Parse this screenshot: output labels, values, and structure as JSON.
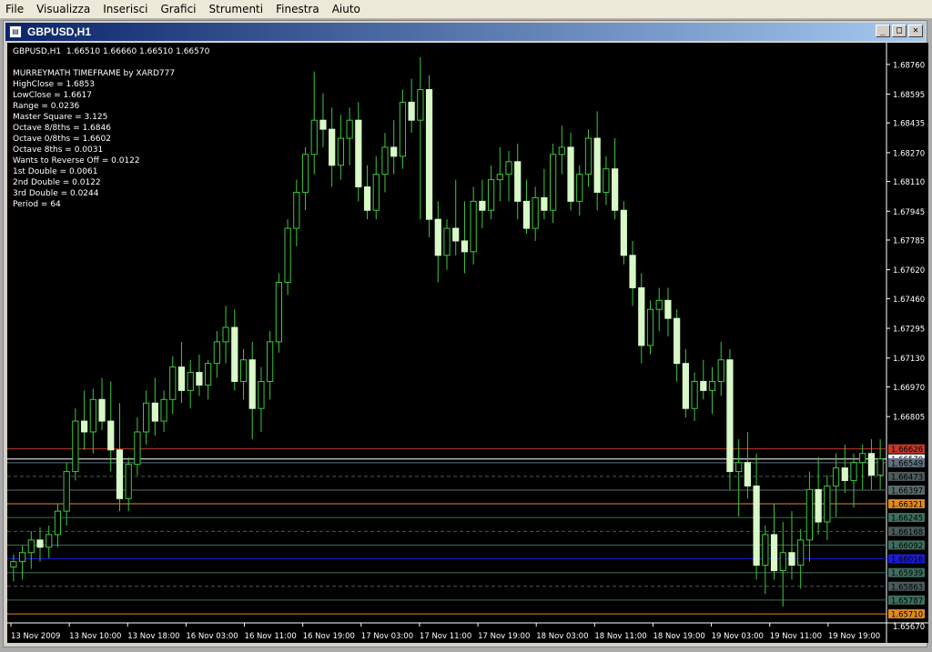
{
  "menu": [
    "File",
    "Visualizza",
    "Inserisci",
    "Grafici",
    "Strumenti",
    "Finestra",
    "Aiuto"
  ],
  "window": {
    "title": "GBPUSD,H1",
    "btn_min": "_",
    "btn_max": "□",
    "btn_close": "✕"
  },
  "chart_header": "GBPUSD,H1  1.66510 1.66660 1.66510 1.66570",
  "indicator_lines": [
    "MURREYMATH TIMEFRAME by XARD777",
    "HighClose = 1.6853",
    "LowClose = 1.6617",
    "Range = 0.0236",
    "Master Square = 3.125",
    "Octave 8/8ths = 1.6846",
    "Octave 0/8ths = 1.6602",
    "Octave 8ths = 0.0031",
    "Wants to Reverse Off = 0.0122",
    "1st Double = 0.0061",
    "2nd Double = 0.0122",
    "3rd Double = 0.0244",
    "Period = 64"
  ],
  "chart_data": {
    "type": "candlestick",
    "symbol": "GBPUSD,H1",
    "ylim": [
      1.6567,
      1.6887
    ],
    "y_ticks": [
      "1.68760",
      "1.68595",
      "1.68435",
      "1.68270",
      "1.68110",
      "1.67945",
      "1.67785",
      "1.67620",
      "1.67460",
      "1.67295",
      "1.67130",
      "1.66970",
      "1.66805"
    ],
    "x_ticks": [
      "13 Nov 2009",
      "13 Nov 10:00",
      "13 Nov 18:00",
      "16 Nov 03:00",
      "16 Nov 11:00",
      "16 Nov 19:00",
      "17 Nov 03:00",
      "17 Nov 11:00",
      "17 Nov 19:00",
      "18 Nov 03:00",
      "18 Nov 11:00",
      "18 Nov 19:00",
      "19 Nov 03:00",
      "19 Nov 11:00",
      "19 Nov 19:00"
    ],
    "levels": [
      {
        "label": "1.66626",
        "value": 1.66626,
        "color": "#c0392b",
        "style": "solid"
      },
      {
        "label": "1.66570",
        "value": 1.6657,
        "color": "#ffffff",
        "style": "solid"
      },
      {
        "label": "1.66549",
        "value": 1.66549,
        "color": "#607080",
        "style": "solid"
      },
      {
        "label": "1.66473",
        "value": 1.66473,
        "color": "#4a5a5a",
        "style": "dashed"
      },
      {
        "label": "1.66397",
        "value": 1.66397,
        "color": "#5a6a6a",
        "style": "solid"
      },
      {
        "label": "1.66321",
        "value": 1.66321,
        "color": "#e08a1e",
        "style": "solid"
      },
      {
        "label": "1.66245",
        "value": 1.66245,
        "color": "#3e6e5e",
        "style": "solid"
      },
      {
        "label": "1.66168",
        "value": 1.66168,
        "color": "#4a5a5a",
        "style": "dashed"
      },
      {
        "label": "1.66092",
        "value": 1.66092,
        "color": "#3e6e5e",
        "style": "solid"
      },
      {
        "label": "1.66016",
        "value": 1.66016,
        "color": "#1c1cd0",
        "style": "solid"
      },
      {
        "label": "1.65939",
        "value": 1.65939,
        "color": "#3e6e5e",
        "style": "solid"
      },
      {
        "label": "1.65863",
        "value": 1.65863,
        "color": "#4a5a5a",
        "style": "dashed"
      },
      {
        "label": "1.65787",
        "value": 1.65787,
        "color": "#3e6e5e",
        "style": "solid"
      },
      {
        "label": "1.65710",
        "value": 1.6571,
        "color": "#e08a1e",
        "style": "solid"
      }
    ],
    "bottom_tick": "1.65670",
    "candles": [
      [
        1.6597,
        1.6604,
        1.6589,
        1.66
      ],
      [
        1.66,
        1.6609,
        1.659,
        1.6605
      ],
      [
        1.6605,
        1.6617,
        1.6596,
        1.6612
      ],
      [
        1.6612,
        1.6619,
        1.66,
        1.6608
      ],
      [
        1.6608,
        1.662,
        1.6602,
        1.6615
      ],
      [
        1.6615,
        1.6632,
        1.6608,
        1.6628
      ],
      [
        1.6628,
        1.6655,
        1.662,
        1.665
      ],
      [
        1.665,
        1.6685,
        1.6645,
        1.6678
      ],
      [
        1.6678,
        1.6695,
        1.6662,
        1.6672
      ],
      [
        1.6672,
        1.6696,
        1.666,
        1.669
      ],
      [
        1.669,
        1.6702,
        1.6673,
        1.6678
      ],
      [
        1.6678,
        1.67,
        1.665,
        1.6662
      ],
      [
        1.6662,
        1.6688,
        1.6628,
        1.6635
      ],
      [
        1.6635,
        1.6658,
        1.6628,
        1.6654
      ],
      [
        1.6654,
        1.668,
        1.6648,
        1.6672
      ],
      [
        1.6672,
        1.6695,
        1.6665,
        1.6688
      ],
      [
        1.6688,
        1.6702,
        1.667,
        1.6678
      ],
      [
        1.6678,
        1.6695,
        1.6672,
        1.669
      ],
      [
        1.669,
        1.6714,
        1.6682,
        1.6708
      ],
      [
        1.6708,
        1.6722,
        1.6688,
        1.6695
      ],
      [
        1.6695,
        1.6712,
        1.6685,
        1.6705
      ],
      [
        1.6705,
        1.6715,
        1.6692,
        1.6698
      ],
      [
        1.6698,
        1.6712,
        1.669,
        1.671
      ],
      [
        1.671,
        1.6728,
        1.6702,
        1.6722
      ],
      [
        1.6722,
        1.6742,
        1.671,
        1.673
      ],
      [
        1.673,
        1.674,
        1.6695,
        1.67
      ],
      [
        1.67,
        1.6718,
        1.669,
        1.6712
      ],
      [
        1.6712,
        1.6722,
        1.6668,
        1.6685
      ],
      [
        1.6685,
        1.6708,
        1.6672,
        1.67
      ],
      [
        1.67,
        1.6728,
        1.669,
        1.6722
      ],
      [
        1.6722,
        1.676,
        1.6716,
        1.6755
      ],
      [
        1.6755,
        1.679,
        1.6748,
        1.6785
      ],
      [
        1.6785,
        1.6812,
        1.6775,
        1.6805
      ],
      [
        1.6805,
        1.683,
        1.6795,
        1.6826
      ],
      [
        1.6826,
        1.6872,
        1.6815,
        1.6845
      ],
      [
        1.6845,
        1.686,
        1.683,
        1.684
      ],
      [
        1.684,
        1.6852,
        1.6808,
        1.682
      ],
      [
        1.682,
        1.6848,
        1.6812,
        1.6835
      ],
      [
        1.6835,
        1.6852,
        1.682,
        1.6845
      ],
      [
        1.6845,
        1.6855,
        1.68,
        1.6808
      ],
      [
        1.6808,
        1.682,
        1.679,
        1.6795
      ],
      [
        1.6795,
        1.6825,
        1.679,
        1.6815
      ],
      [
        1.6815,
        1.6838,
        1.6805,
        1.683
      ],
      [
        1.683,
        1.6845,
        1.6815,
        1.6825
      ],
      [
        1.6825,
        1.6862,
        1.6818,
        1.6855
      ],
      [
        1.6855,
        1.6868,
        1.6838,
        1.6845
      ],
      [
        1.6845,
        1.688,
        1.679,
        1.6862
      ],
      [
        1.6862,
        1.687,
        1.678,
        1.679
      ],
      [
        1.679,
        1.68,
        1.6755,
        1.677
      ],
      [
        1.677,
        1.679,
        1.6762,
        1.6785
      ],
      [
        1.6785,
        1.6812,
        1.677,
        1.6778
      ],
      [
        1.6778,
        1.68,
        1.676,
        1.6772
      ],
      [
        1.6772,
        1.6808,
        1.6765,
        1.68
      ],
      [
        1.68,
        1.6812,
        1.6785,
        1.6795
      ],
      [
        1.6795,
        1.682,
        1.679,
        1.6812
      ],
      [
        1.6812,
        1.683,
        1.68,
        1.6815
      ],
      [
        1.6815,
        1.6828,
        1.68,
        1.6822
      ],
      [
        1.6822,
        1.6832,
        1.679,
        1.68
      ],
      [
        1.68,
        1.6812,
        1.6782,
        1.6785
      ],
      [
        1.6785,
        1.6808,
        1.6778,
        1.6802
      ],
      [
        1.6802,
        1.6818,
        1.679,
        1.6795
      ],
      [
        1.6795,
        1.6832,
        1.6788,
        1.6826
      ],
      [
        1.6826,
        1.6842,
        1.6815,
        1.683
      ],
      [
        1.683,
        1.6838,
        1.6795,
        1.68
      ],
      [
        1.68,
        1.682,
        1.6792,
        1.6815
      ],
      [
        1.6815,
        1.684,
        1.6808,
        1.6835
      ],
      [
        1.6835,
        1.685,
        1.6795,
        1.6805
      ],
      [
        1.6805,
        1.6825,
        1.6798,
        1.6818
      ],
      [
        1.6818,
        1.6835,
        1.679,
        1.6795
      ],
      [
        1.6795,
        1.68,
        1.6765,
        1.677
      ],
      [
        1.677,
        1.6778,
        1.6742,
        1.6752
      ],
      [
        1.6752,
        1.676,
        1.671,
        1.672
      ],
      [
        1.672,
        1.6745,
        1.6715,
        1.674
      ],
      [
        1.674,
        1.6752,
        1.6728,
        1.6745
      ],
      [
        1.6745,
        1.6752,
        1.6725,
        1.6735
      ],
      [
        1.6735,
        1.674,
        1.67,
        1.671
      ],
      [
        1.671,
        1.6718,
        1.668,
        1.6685
      ],
      [
        1.6685,
        1.6705,
        1.6678,
        1.67
      ],
      [
        1.67,
        1.6712,
        1.669,
        1.6695
      ],
      [
        1.6695,
        1.6708,
        1.6682,
        1.67
      ],
      [
        1.67,
        1.6722,
        1.6692,
        1.6712
      ],
      [
        1.6712,
        1.6718,
        1.664,
        1.665
      ],
      [
        1.665,
        1.6668,
        1.6625,
        1.6655
      ],
      [
        1.6655,
        1.6672,
        1.6635,
        1.6642
      ],
      [
        1.6642,
        1.666,
        1.659,
        1.6598
      ],
      [
        1.6598,
        1.662,
        1.6582,
        1.6615
      ],
      [
        1.6615,
        1.6632,
        1.659,
        1.6595
      ],
      [
        1.6595,
        1.6622,
        1.6575,
        1.6605
      ],
      [
        1.6605,
        1.6628,
        1.659,
        1.6598
      ],
      [
        1.6598,
        1.6618,
        1.6585,
        1.6612
      ],
      [
        1.6612,
        1.665,
        1.66,
        1.664
      ],
      [
        1.664,
        1.6658,
        1.6615,
        1.6622
      ],
      [
        1.6622,
        1.6648,
        1.6612,
        1.6642
      ],
      [
        1.6642,
        1.666,
        1.6625,
        1.6652
      ],
      [
        1.6652,
        1.6665,
        1.6638,
        1.6645
      ],
      [
        1.6645,
        1.666,
        1.663,
        1.6655
      ],
      [
        1.6655,
        1.6665,
        1.664,
        1.666
      ],
      [
        1.666,
        1.6668,
        1.664,
        1.6648
      ],
      [
        1.6648,
        1.6668,
        1.664,
        1.6657
      ]
    ]
  }
}
